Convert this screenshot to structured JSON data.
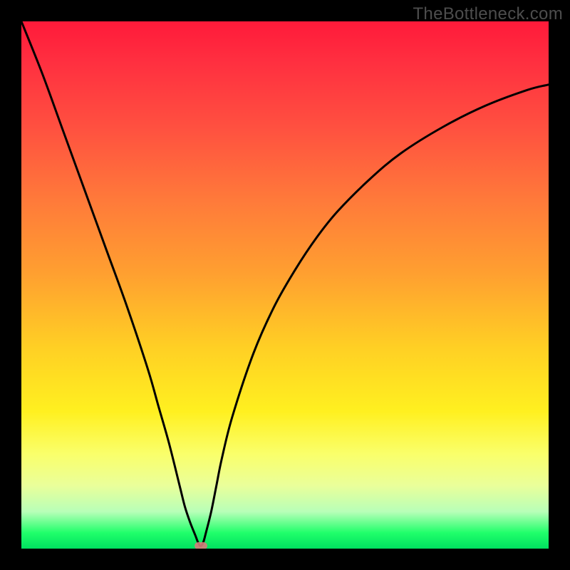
{
  "watermark": "TheBottleneck.com",
  "colors": {
    "frame_border": "#000000",
    "curve_stroke": "#000000",
    "minima_dot": "#d67b7b",
    "gradient_top": "#ff1a3a",
    "gradient_bottom": "#00e060"
  },
  "chart_data": {
    "type": "line",
    "title": "",
    "xlabel": "",
    "ylabel": "",
    "xlim": [
      0,
      100
    ],
    "ylim": [
      0,
      100
    ],
    "x_minimum_position": 34,
    "series": [
      {
        "name": "bottleneck-curve",
        "x": [
          0,
          4,
          8,
          12,
          16,
          20,
          24,
          26,
          28,
          30,
          31,
          32,
          33,
          33.5,
          34,
          34.5,
          35,
          36,
          37,
          38,
          40,
          44,
          48,
          52,
          56,
          60,
          66,
          72,
          80,
          88,
          96,
          100
        ],
        "values": [
          100,
          90,
          79,
          68,
          57,
          46,
          34,
          27,
          20,
          12,
          8,
          5,
          2.5,
          1.2,
          0.5,
          1.2,
          3,
          7,
          12,
          17,
          25,
          37,
          46,
          53,
          59,
          64,
          70,
          75,
          80,
          84,
          87,
          88
        ]
      }
    ],
    "annotations": [
      {
        "name": "optimum-marker",
        "x": 34,
        "y": 0.5
      }
    ]
  }
}
